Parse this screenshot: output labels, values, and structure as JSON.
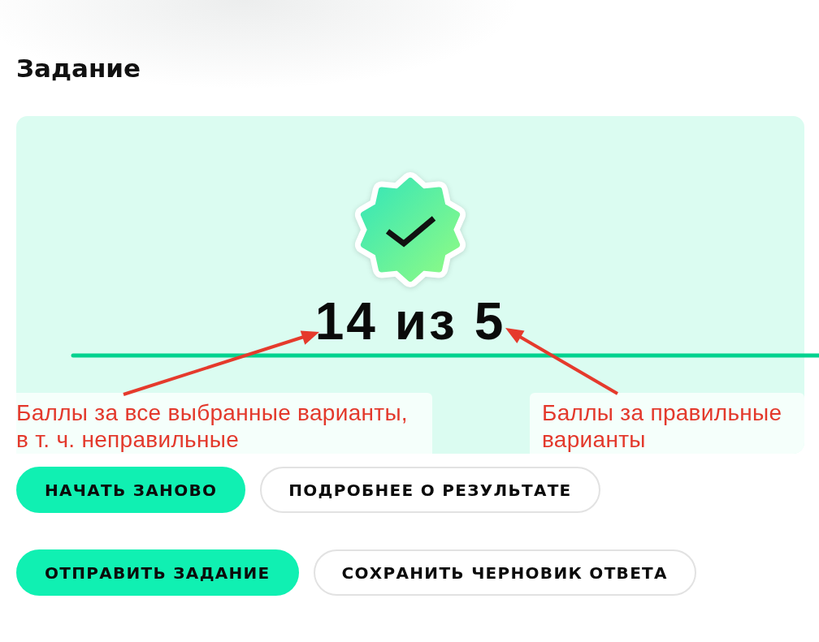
{
  "title": "Задание",
  "result": {
    "score": "14 из 5"
  },
  "annotations": [
    {
      "text": "Баллы за все выбранные варианты, в т. ч. неправильные"
    },
    {
      "text": "Баллы за правильные варианты"
    }
  ],
  "button_rows": [
    [
      {
        "label": "НАЧАТЬ ЗАНОВО",
        "kind": "primary"
      },
      {
        "label": "ПОДРОБНЕЕ О РЕЗУЛЬТАТЕ",
        "kind": "secondary"
      }
    ],
    [
      {
        "label": "ОТПРАВИТЬ ЗАДАНИЕ",
        "kind": "primary"
      },
      {
        "label": "СОХРАНИТЬ ЧЕРНОВИК ОТВЕТА",
        "kind": "secondary"
      }
    ]
  ]
}
